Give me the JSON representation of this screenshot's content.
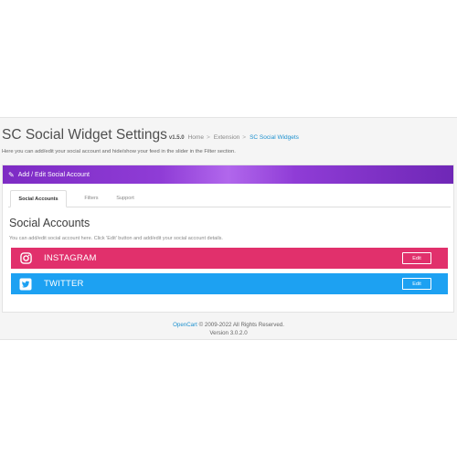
{
  "header": {
    "title": "SC Social Widget Settings",
    "version": "v1.5.0",
    "breadcrumb": [
      "Home",
      "Extension",
      "SC Social Widgets"
    ],
    "separator": ">",
    "subtitle": "Here you can add/edit your social account and hide/show your feed in the slider in the Filter section."
  },
  "panel": {
    "heading": "Add / Edit Social Account",
    "tabs": [
      "Social Accounts",
      "Filters",
      "Support"
    ]
  },
  "section": {
    "title": "Social Accounts",
    "description": "You can add/edit social account here. Click 'Edit' button and add/edit your social account details."
  },
  "accounts": [
    {
      "name": "INSTAGRAM",
      "icon": "instagram-icon",
      "color": "#e1306c",
      "edit_label": "Edit"
    },
    {
      "name": "TWITTER",
      "icon": "twitter-icon",
      "color": "#1da1f2",
      "edit_label": "Edit"
    }
  ],
  "footer": {
    "link": "OpenCart",
    "copyright": "© 2009-2022 All Rights Reserved.",
    "version": "Version 3.0.2.0"
  },
  "colors": {
    "panel_gradient_start": "#7d2bc4",
    "panel_gradient_mid": "#b167ec",
    "link": "#1e91cf"
  }
}
